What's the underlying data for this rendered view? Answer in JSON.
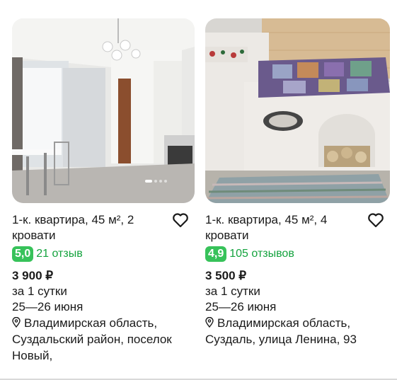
{
  "listings": [
    {
      "title": "1-к. квартира, 45 м², 2 кровати",
      "rating": "5,0",
      "reviews": "21 отзыв",
      "price": "3 900 ₽",
      "period": "за 1 сутки",
      "dates": "25—26 июня",
      "address": "Владимирская область, Суздальский район, поселок Новый,",
      "photo_subject": "white kitchen with chandelier",
      "favorite_icon": "heart-outline-icon"
    },
    {
      "title": "1-к. квартира, 45 м², 4 кровати",
      "rating": "4,9",
      "reviews": "105 отзывов",
      "price": "3 500 ₽",
      "period": "за 1 сутки",
      "dates": "25—26 июня",
      "address": "Владимирская область, Суздаль, улица Ленина, 93",
      "photo_subject": "russian stove bed with patchwork quilt and rug",
      "favorite_icon": "heart-outline-icon"
    }
  ],
  "colors": {
    "rating_badge": "#37c25a",
    "reviews_text": "#14a33e"
  }
}
